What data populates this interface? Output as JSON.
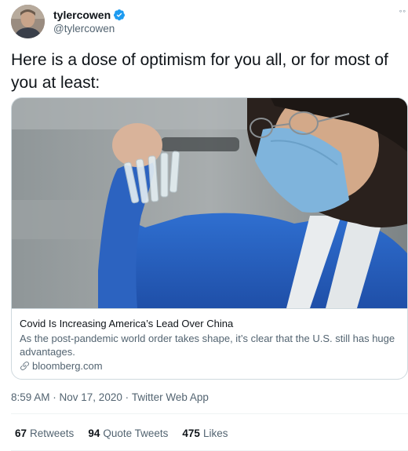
{
  "user": {
    "display_name": "tylercowen",
    "handle": "@tylercowen",
    "verified": true
  },
  "tweet": {
    "text": "Here is a dose of optimism for you all, or for most of you at least:"
  },
  "card": {
    "title": "Covid Is Increasing America’s Lead Over China",
    "description": "As the post-pandemic world order takes shape, it’s clear that the U.S. still has huge advantages.",
    "domain": "bloomberg.com"
  },
  "meta": {
    "time": "8:59 AM",
    "separator": " · ",
    "date": "Nov 17, 2020",
    "source": "Twitter Web App"
  },
  "stats": {
    "retweets_count": "67",
    "retweets_label": "Retweets",
    "quotes_count": "94",
    "quotes_label": "Quote Tweets",
    "likes_count": "475",
    "likes_label": "Likes"
  },
  "colors": {
    "accent": "#1d9bf0",
    "text_primary": "#0f1419",
    "text_secondary": "#536471",
    "border": "#cfd9de"
  },
  "icons": [
    "verified-badge-icon",
    "more-options-icon",
    "link-icon"
  ]
}
